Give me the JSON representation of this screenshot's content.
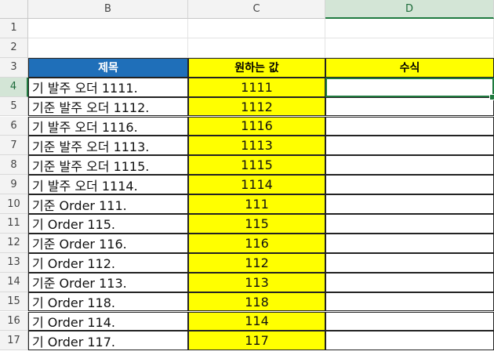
{
  "columns": [
    "B",
    "C",
    "D"
  ],
  "rows": [
    "1",
    "2",
    "3",
    "4",
    "5",
    "6",
    "7",
    "8",
    "9",
    "10",
    "11",
    "12",
    "13",
    "14",
    "15",
    "16",
    "17"
  ],
  "headers": {
    "title": "제목",
    "desired": "원하는 값",
    "formula": "수식"
  },
  "data": [
    {
      "title": "기 발주 오더 1111.",
      "value": "1111"
    },
    {
      "title": "기준 발주 오더 1112.",
      "value": "1112"
    },
    {
      "title": "기 발주 오더 1116.",
      "value": "1116"
    },
    {
      "title": "기준 발주 오더 1113.",
      "value": "1113"
    },
    {
      "title": "기준 발주 오더 1115.",
      "value": "1115"
    },
    {
      "title": "기 발주 오더 1114.",
      "value": "1114"
    },
    {
      "title": "기준 Order 111.",
      "value": "111"
    },
    {
      "title": "기 Order 115.",
      "value": "115"
    },
    {
      "title": "기준 Order 116.",
      "value": "116"
    },
    {
      "title": "기 Order 112.",
      "value": "112"
    },
    {
      "title": "기준 Order 113.",
      "value": "113"
    },
    {
      "title": "기 Order 118.",
      "value": "118"
    },
    {
      "title": "기 Order 114.",
      "value": "114"
    },
    {
      "title": "기 Order 117.",
      "value": "117"
    }
  ],
  "colors": {
    "header_blue": "#1f6fb9",
    "highlight_yellow": "#ffff00",
    "selection_green": "#1f7a3f"
  }
}
